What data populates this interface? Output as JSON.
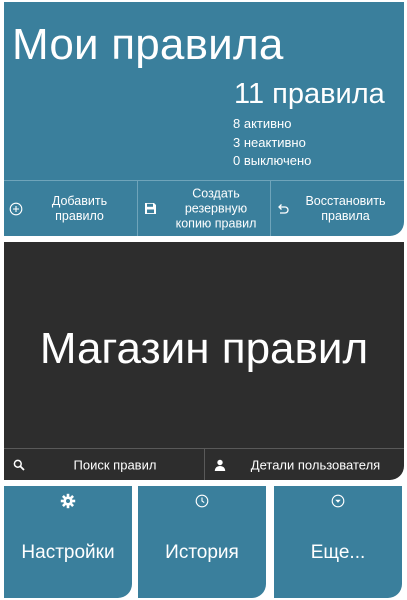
{
  "my_rules": {
    "title": "Мои правила",
    "count": "11 правила",
    "active": "8 активно",
    "inactive": "3 неактивно",
    "disabled": "0 выключено",
    "actions": {
      "add_label": "Добавить правило",
      "backup_label": "Создать резервную копию правил",
      "restore_label": "Восстановить правила"
    }
  },
  "rule_store": {
    "title": "Магазин правил",
    "search_label": "Поиск правил",
    "user_details_label": "Детали пользователя"
  },
  "tiles": {
    "settings_label": "Настройки",
    "history_label": "История",
    "more_label": "Еще..."
  },
  "icons": {
    "add": "plus-circle-icon",
    "backup": "floppy-disk-icon",
    "restore": "undo-arrow-icon",
    "search": "search-icon",
    "user": "user-icon",
    "settings": "gear-icon",
    "history": "clock-icon",
    "more": "chevron-down-circle-icon"
  },
  "colors": {
    "accent": "#3a7f9c",
    "dark": "#2d2d2d",
    "text": "#ffffff"
  }
}
